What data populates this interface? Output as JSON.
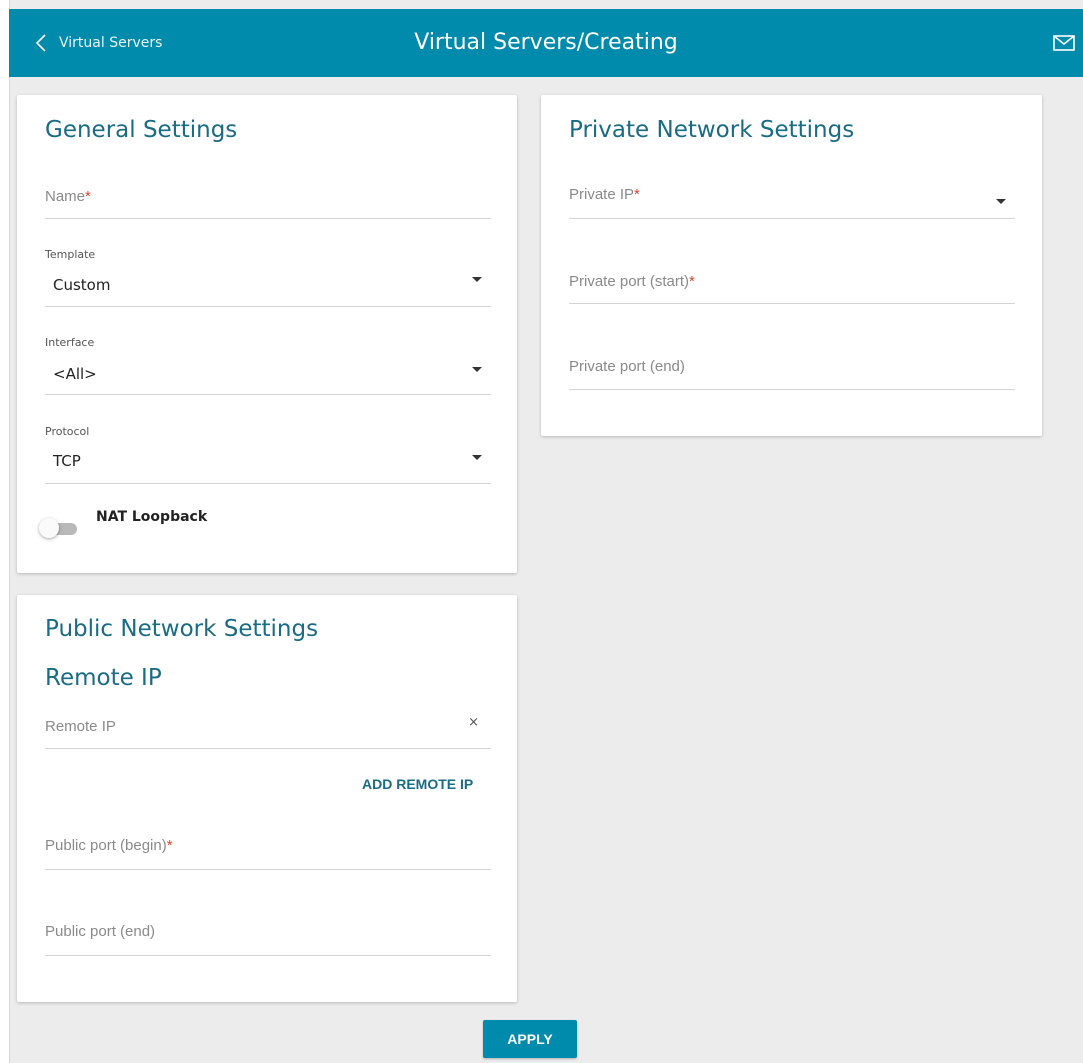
{
  "header": {
    "back_label": "Virtual Servers",
    "title": "Virtual Servers/Creating",
    "mail_icon": "envelope-icon"
  },
  "general": {
    "title": "General Settings",
    "name_placeholder": "Name",
    "required_mark": "*",
    "template_label": "Template",
    "template_value": "Custom",
    "interface_label": "Interface",
    "interface_value": "<All>",
    "protocol_label": "Protocol",
    "protocol_value": "TCP",
    "nat_loopback_label": "NAT Loopback",
    "nat_loopback_enabled": false
  },
  "private": {
    "title": "Private Network Settings",
    "private_ip_placeholder": "Private IP",
    "port_start_placeholder": "Private port (start)",
    "port_end_placeholder": "Private port (end)"
  },
  "public": {
    "title": "Public Network Settings",
    "remote_ip_title": "Remote IP",
    "remote_ip_placeholder": "Remote IP",
    "clear_symbol": "×",
    "add_remote_ip_label": "ADD REMOTE IP",
    "port_begin_placeholder": "Public port (begin)",
    "port_end_placeholder": "Public port (end)"
  },
  "apply_label": "APPLY",
  "colors": {
    "accent": "#008aab",
    "heading": "#1a6b84",
    "required": "#d9432f",
    "background": "#ececec"
  }
}
